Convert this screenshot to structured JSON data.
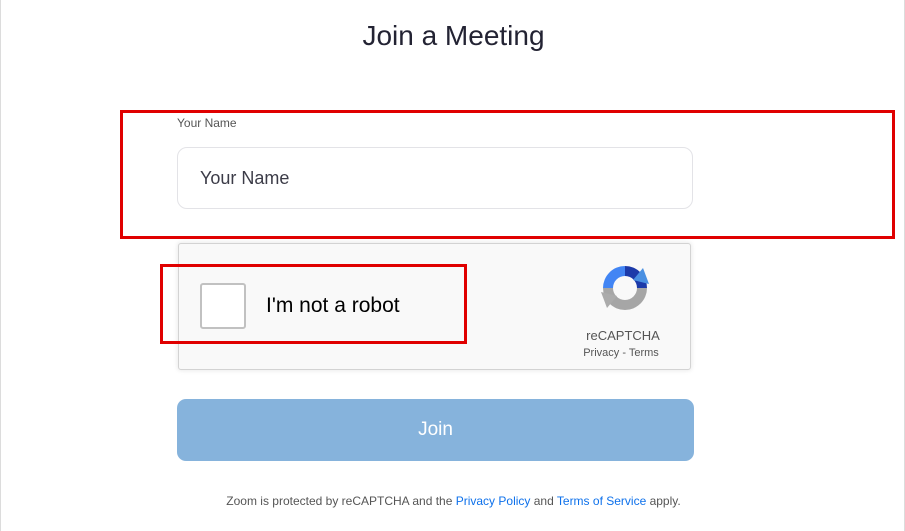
{
  "page": {
    "title": "Join a Meeting"
  },
  "form": {
    "name_label": "Your Name",
    "name_placeholder": "Your Name",
    "name_value": ""
  },
  "recaptcha": {
    "checkbox_label": "I'm not a robot",
    "checked": false,
    "brand": "reCAPTCHA",
    "privacy_link": "Privacy",
    "separator": " - ",
    "terms_link": "Terms",
    "logo_icon": "recaptcha-logo-icon"
  },
  "join_button": {
    "label": "Join",
    "disabled": true,
    "color": "#86b3dc"
  },
  "footer": {
    "prefix": "Zoom is protected by reCAPTCHA and the ",
    "privacy_link": "Privacy Policy",
    "middle": " and ",
    "terms_link": "Terms of Service",
    "suffix": " apply.",
    "link_color": "#0e71eb"
  },
  "annotations": {
    "highlight_color": "#e00000"
  }
}
